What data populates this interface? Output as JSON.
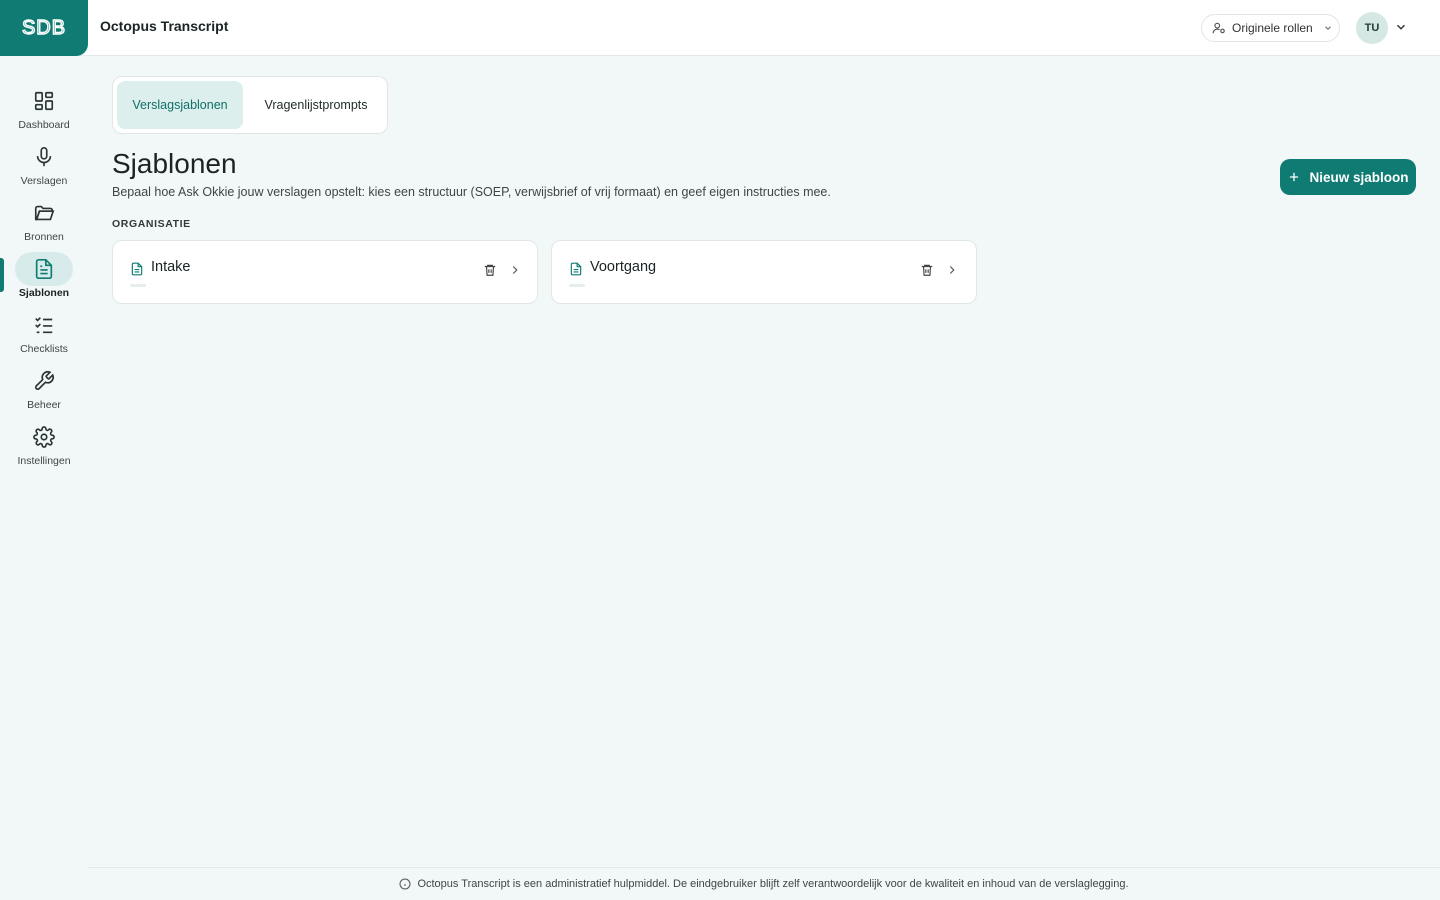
{
  "app": {
    "title": "Octopus Transcript",
    "logo_text": "SDB"
  },
  "header": {
    "role_label": "Originele rollen",
    "avatar_initials": "TU"
  },
  "sidebar": {
    "items": [
      {
        "label": "Dashboard",
        "icon": "dashboard-icon"
      },
      {
        "label": "Verslagen",
        "icon": "microphone-icon"
      },
      {
        "label": "Bronnen",
        "icon": "folder-icon"
      },
      {
        "label": "Sjablonen",
        "icon": "document-icon",
        "active": true
      },
      {
        "label": "Checklists",
        "icon": "checklist-icon"
      },
      {
        "label": "Beheer",
        "icon": "wrench-icon"
      },
      {
        "label": "Instellingen",
        "icon": "gear-icon"
      }
    ]
  },
  "tabs": [
    {
      "label": "Verslagsjablonen",
      "active": true
    },
    {
      "label": "Vragenlijstprompts",
      "active": false
    }
  ],
  "main": {
    "title": "Sjablonen",
    "subtitle": "Bepaal hoe Ask Okkie jouw verslagen opstelt: kies een structuur (SOEP, verwijsbrief of vrij formaat) en geef eigen instructies mee.",
    "new_button": "Nieuw sjabloon",
    "section_label": "ORGANISATIE",
    "templates": [
      {
        "name": "Intake"
      },
      {
        "name": "Voortgang"
      }
    ]
  },
  "footer": {
    "text": "Octopus Transcript is een administratief hulpmiddel. De eindgebruiker blijft zelf verantwoordelijk voor de kwaliteit en inhoud van de verslaglegging."
  },
  "colors": {
    "accent": "#0f7b73",
    "background": "#f2f7f7",
    "active_tab_bg": "#dcefed"
  }
}
